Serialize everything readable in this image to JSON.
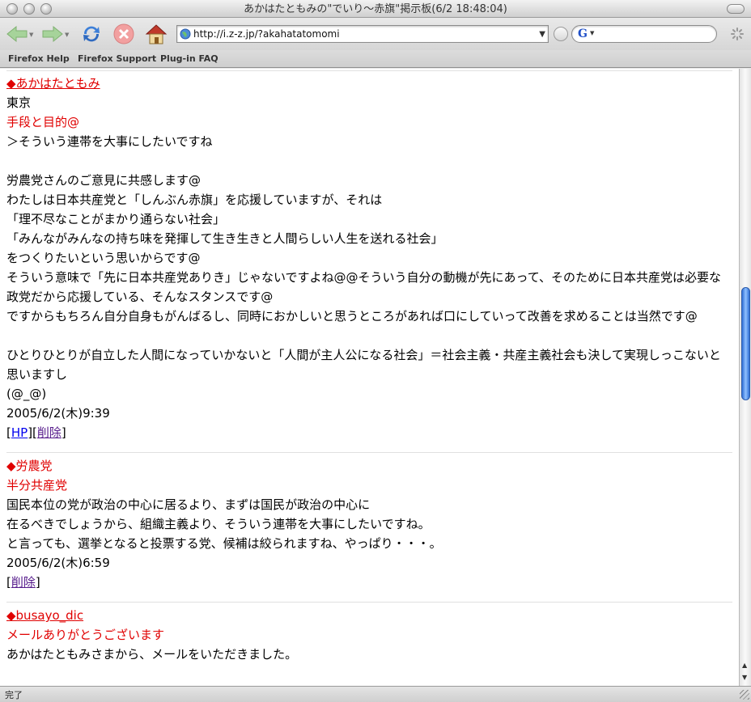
{
  "window": {
    "title": "あかはたともみの\"でいり〜赤旗\"掲示板(6/2 18:48:04)"
  },
  "toolbar": {
    "url": "http://i.z-z.jp/?akahatatomomi",
    "search_placeholder": ""
  },
  "bookmarks": [
    "Firefox Help",
    "Firefox Support",
    "Plug-in FAQ"
  ],
  "posts": [
    {
      "name": "◆あかはたともみ",
      "location": "東京",
      "subject": "手段と目的@",
      "lines": [
        "＞そういう連帯を大事にしたいですね",
        "",
        "労農党さんのご意見に共感します@",
        "わたしは日本共産党と「しんぶん赤旗」を応援していますが、それは",
        "「理不尽なことがまかり通らない社会」",
        "「みんながみんなの持ち味を発揮して生き生きと人間らしい人生を送れる社会」",
        "をつくりたいという思いからです@",
        "そういう意味で「先に日本共産党ありき」じゃないですよね@@そういう自分の動機が先にあって、そのために日本共産党は必要な政党だから応援している、そんなスタンスです@",
        "ですからもちろん自分自身もがんばるし、同時におかしいと思うところがあれば口にしていって改善を求めることは当然です@",
        "ひとりひとりが自立した人間になっていかないと「人間が主人公になる社会」＝社会主義・共産主義社会も決して実現しっこないと思いますし",
        "(@_@)"
      ],
      "date": "2005/6/2(木)9:39",
      "hp_label": "HP",
      "delete_label": "削除"
    },
    {
      "name": "◆労農党",
      "subject": "半分共産党",
      "lines": [
        "国民本位の党が政治の中心に居るより、まずは国民が政治の中心に",
        "在るべきでしょうから、組織主義より、そういう連帯を大事にしたいですね。",
        "と言っても、選挙となると投票する党、候補は絞られますね、やっぱり・・・。"
      ],
      "date": "2005/6/2(木)6:59",
      "delete_label": "削除"
    },
    {
      "name": "◆busayo_dic",
      "subject": "メールありがとうございます",
      "lines": [
        "あかはたともみさまから、メールをいただきました。"
      ]
    }
  ],
  "status": {
    "text": "完了"
  }
}
